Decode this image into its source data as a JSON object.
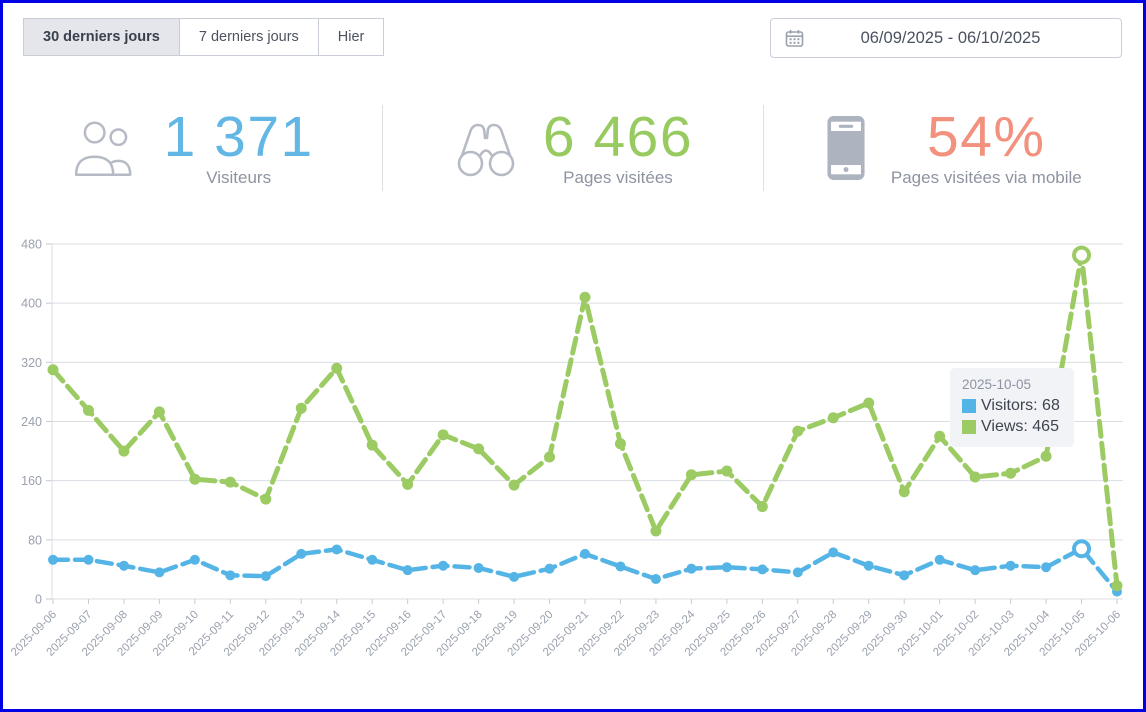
{
  "tabs": [
    {
      "label": "30 derniers jours",
      "active": true
    },
    {
      "label": "7 derniers jours",
      "active": false
    },
    {
      "label": "Hier",
      "active": false
    }
  ],
  "datepicker": {
    "value": "06/09/2025 - 06/10/2025"
  },
  "stats": [
    {
      "icon": "visitors-icon",
      "value": "1 371",
      "label": "Visiteurs",
      "color": "#62b7e5"
    },
    {
      "icon": "binoculars-icon",
      "value": "6 466",
      "label": "Pages visitées",
      "color": "#97ca5f"
    },
    {
      "icon": "mobile-icon",
      "value": "54%",
      "label": "Pages visitées via mobile",
      "color": "#f1917e"
    }
  ],
  "chart_data": {
    "type": "line",
    "title": "",
    "xlabel": "",
    "ylabel": "",
    "ylim": [
      0,
      480
    ],
    "yticks": [
      0,
      80,
      160,
      240,
      320,
      400,
      480
    ],
    "grid": true,
    "legend_position": "none",
    "x": [
      "2025-09-06",
      "2025-09-07",
      "2025-09-08",
      "2025-09-09",
      "2025-09-10",
      "2025-09-11",
      "2025-09-12",
      "2025-09-13",
      "2025-09-14",
      "2025-09-15",
      "2025-09-16",
      "2025-09-17",
      "2025-09-18",
      "2025-09-19",
      "2025-09-20",
      "2025-09-21",
      "2025-09-22",
      "2025-09-23",
      "2025-09-24",
      "2025-09-25",
      "2025-09-26",
      "2025-09-27",
      "2025-09-28",
      "2025-09-29",
      "2025-09-30",
      "2025-10-01",
      "2025-10-02",
      "2025-10-03",
      "2025-10-04",
      "2025-10-05",
      "2025-10-06"
    ],
    "series": [
      {
        "name": "Visitors",
        "color": "#55b4e6",
        "values": [
          53,
          53,
          45,
          36,
          53,
          32,
          31,
          61,
          67,
          53,
          39,
          45,
          42,
          30,
          41,
          61,
          44,
          27,
          41,
          43,
          40,
          36,
          63,
          45,
          32,
          53,
          39,
          45,
          43,
          68,
          10
        ]
      },
      {
        "name": "Views",
        "color": "#9ccb64",
        "values": [
          310,
          255,
          200,
          253,
          162,
          158,
          135,
          258,
          312,
          208,
          155,
          222,
          203,
          154,
          192,
          408,
          210,
          92,
          168,
          173,
          125,
          227,
          245,
          265,
          145,
          220,
          165,
          170,
          193,
          465,
          18
        ]
      }
    ],
    "highlight_index": 29,
    "tooltip": {
      "title": "2025-10-05",
      "entries": [
        {
          "text": "Visitors: 68",
          "color": "#55b4e6"
        },
        {
          "text": "Views: 465",
          "color": "#9ccb64"
        }
      ]
    },
    "axis_color": "#9aa1ad",
    "grid_color": "#dadde2"
  }
}
